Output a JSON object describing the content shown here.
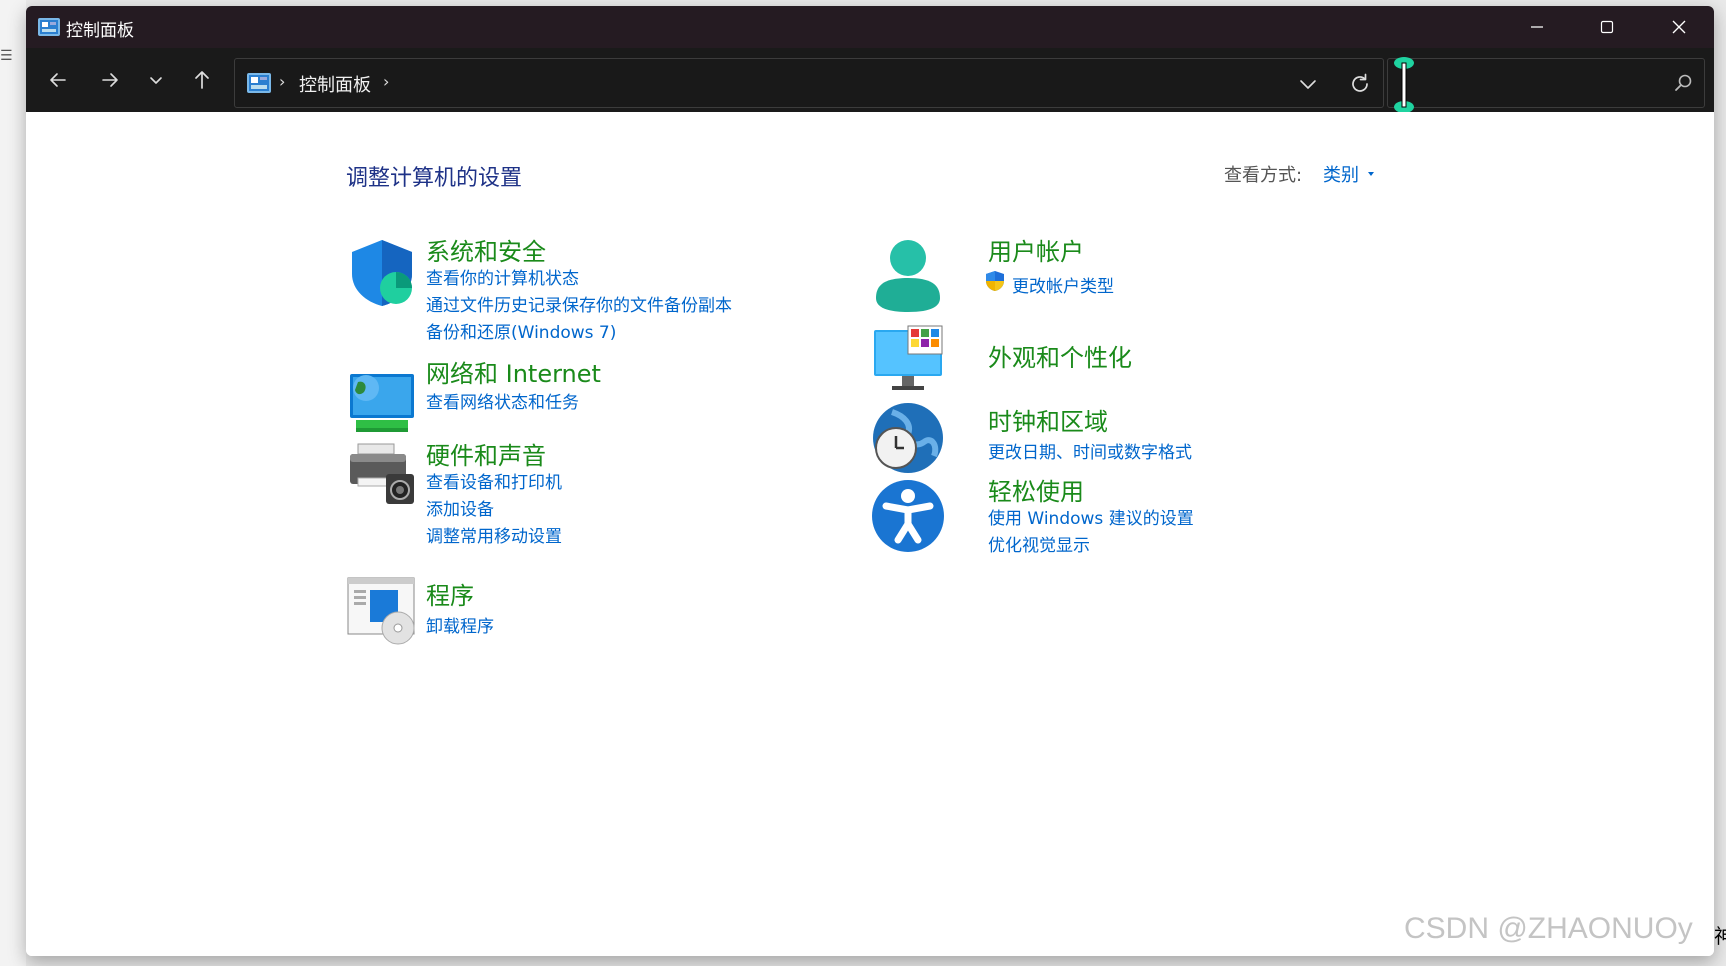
{
  "window": {
    "title": "控制面板",
    "minimize_label": "minimize",
    "maximize_label": "maximize",
    "close_label": "close"
  },
  "navigation": {
    "breadcrumb": [
      "控制面板"
    ],
    "search_placeholder": ""
  },
  "content": {
    "heading": "调整计算机的设置",
    "view_by_label": "查看方式:",
    "view_by_value": "类别"
  },
  "categories": [
    {
      "title": "系统和安全",
      "icon": "shield-icon",
      "links": [
        "查看你的计算机状态",
        "通过文件历史记录保存你的文件备份副本",
        "备份和还原(Windows 7)"
      ]
    },
    {
      "title": "网络和 Internet",
      "icon": "network-icon",
      "links": [
        "查看网络状态和任务"
      ]
    },
    {
      "title": "硬件和声音",
      "icon": "printer-icon",
      "links": [
        "查看设备和打印机",
        "添加设备",
        "调整常用移动设置"
      ]
    },
    {
      "title": "程序",
      "icon": "programs-icon",
      "links": [
        "卸载程序"
      ]
    },
    {
      "title": "用户帐户",
      "icon": "user-icon",
      "links": [
        "更改帐户类型"
      ]
    },
    {
      "title": "外观和个性化",
      "icon": "monitor-icon",
      "links": []
    },
    {
      "title": "时钟和区域",
      "icon": "clock-globe-icon",
      "links": [
        "更改日期、时间或数字格式"
      ]
    },
    {
      "title": "轻松使用",
      "icon": "accessibility-icon",
      "links": [
        "使用 Windows 建议的设置",
        "优化视觉显示"
      ]
    }
  ],
  "watermark": "CSDN @ZHAONUOy",
  "background": {
    "edge_char": "神"
  },
  "colors": {
    "titlebar": "#251b22",
    "navbar": "#1a1a1a",
    "category_title": "#1a8a1a",
    "link": "#0066cc",
    "heading": "#1e3287"
  }
}
